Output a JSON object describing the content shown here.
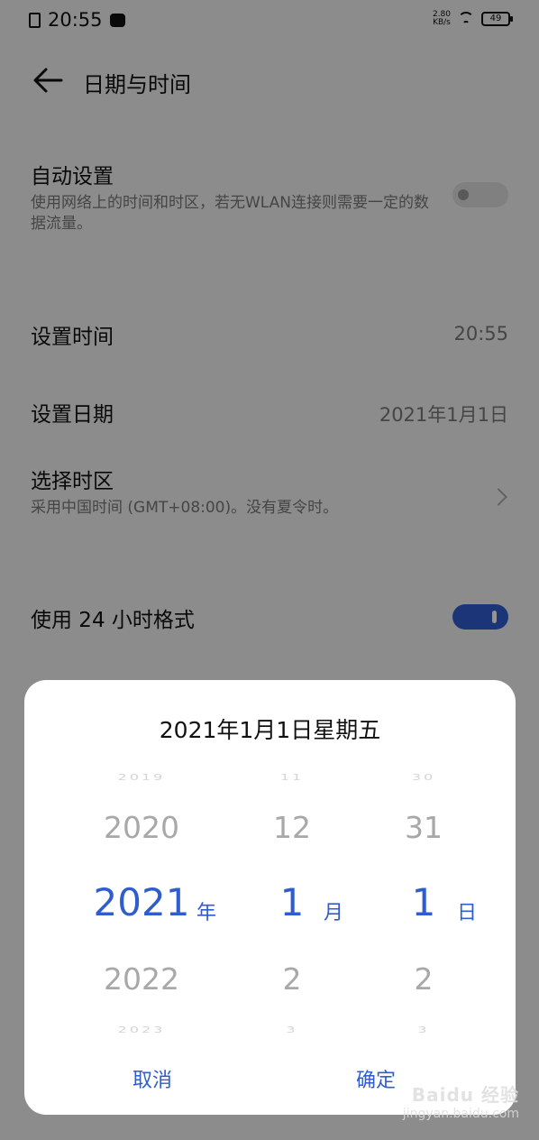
{
  "status_bar": {
    "time": "20:55",
    "net_speed_value": "2.80",
    "net_speed_unit": "KB/s",
    "battery": "49",
    "icons": [
      "sim-icon",
      "message-icon",
      "wifi-icon",
      "battery-icon"
    ]
  },
  "header": {
    "title": "日期与时间",
    "back_icon": "arrow-left-icon"
  },
  "settings": {
    "auto": {
      "title": "自动设置",
      "subtitle": "使用网络上的时间和时区，若无WLAN连接则需要一定的数据流量。",
      "enabled": false
    },
    "set_time": {
      "title": "设置时间",
      "value": "20:55"
    },
    "set_date": {
      "title": "设置日期",
      "value": "2021年1月1日"
    },
    "timezone": {
      "title": "选择时区",
      "subtitle": "采用中国时间 (GMT+08:00)。没有夏令时。",
      "icon": "chevron-right-icon"
    },
    "format_24h": {
      "title": "使用 24 小时格式",
      "enabled": true
    }
  },
  "dialog": {
    "title": "2021年1月1日星期五",
    "year": {
      "items": [
        "2019",
        "2020",
        "2021",
        "2022",
        "2023"
      ],
      "selected": "2021",
      "unit": "年"
    },
    "month": {
      "items": [
        "11",
        "12",
        "1",
        "2",
        "3"
      ],
      "selected": "1",
      "unit": "月"
    },
    "day": {
      "items": [
        "30",
        "31",
        "1",
        "2",
        "3"
      ],
      "selected": "1",
      "unit": "日"
    },
    "cancel_label": "取消",
    "ok_label": "确定"
  },
  "watermark": {
    "brand": "Baidu 经验",
    "url": "jingyan.baidu.com"
  },
  "colors": {
    "accent": "#2f5ccf",
    "background": "#f2f2f2",
    "dialog": "#ffffff"
  }
}
